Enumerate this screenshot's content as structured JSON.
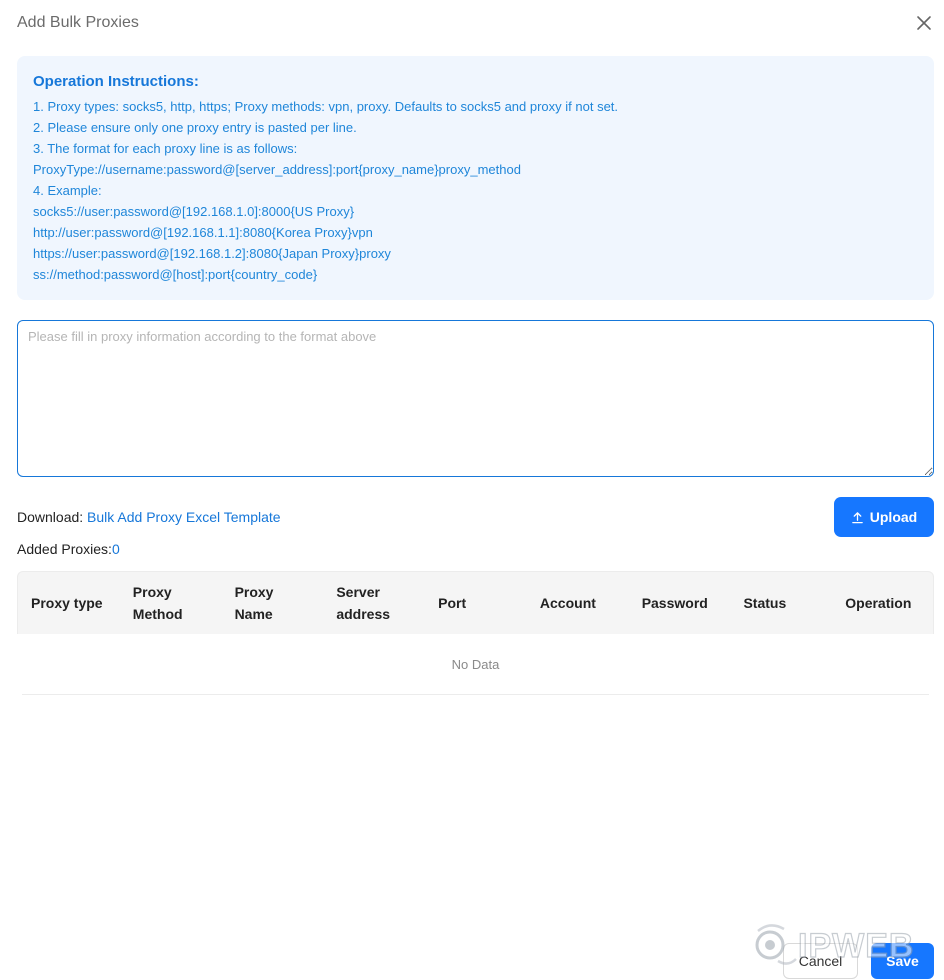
{
  "dialog": {
    "title": "Add Bulk Proxies"
  },
  "instructions": {
    "heading": "Operation Instructions:",
    "lines": [
      "1. Proxy types: socks5, http, https; Proxy methods: vpn, proxy. Defaults to socks5 and proxy if not set.",
      "2. Please ensure only one proxy entry is pasted per line.",
      "3. The format for each proxy line is as follows:",
      "ProxyType://username:password@[server_address]:port{proxy_name}proxy_method",
      "4. Example:",
      "socks5://user:password@[192.168.1.0]:8000{US Proxy}",
      "http://user:password@[192.168.1.1]:8080{Korea Proxy}vpn",
      "https://user:password@[192.168.1.2]:8080{Japan Proxy}proxy",
      "ss://method:password@[host]:port{country_code}"
    ]
  },
  "textarea": {
    "placeholder": "Please fill in proxy information according to the format above",
    "value": ""
  },
  "download": {
    "label": "Download: ",
    "link_text": "Bulk Add Proxy Excel Template"
  },
  "upload": {
    "label": "Upload"
  },
  "added": {
    "label": "Added Proxies:",
    "count": "0"
  },
  "table": {
    "columns": [
      "Proxy type",
      "Proxy Method",
      "Proxy Name",
      "Server address",
      "Port",
      "Account",
      "Password",
      "Status",
      "Operation"
    ],
    "empty_text": "No Data"
  },
  "footer": {
    "cancel_label": "Cancel",
    "save_label": "Save"
  },
  "watermark": {
    "text": "IPWEB"
  },
  "colors": {
    "accent": "#1677ff",
    "instruction_text": "#1f86d9",
    "instruction_bg": "#f0f6fe"
  }
}
